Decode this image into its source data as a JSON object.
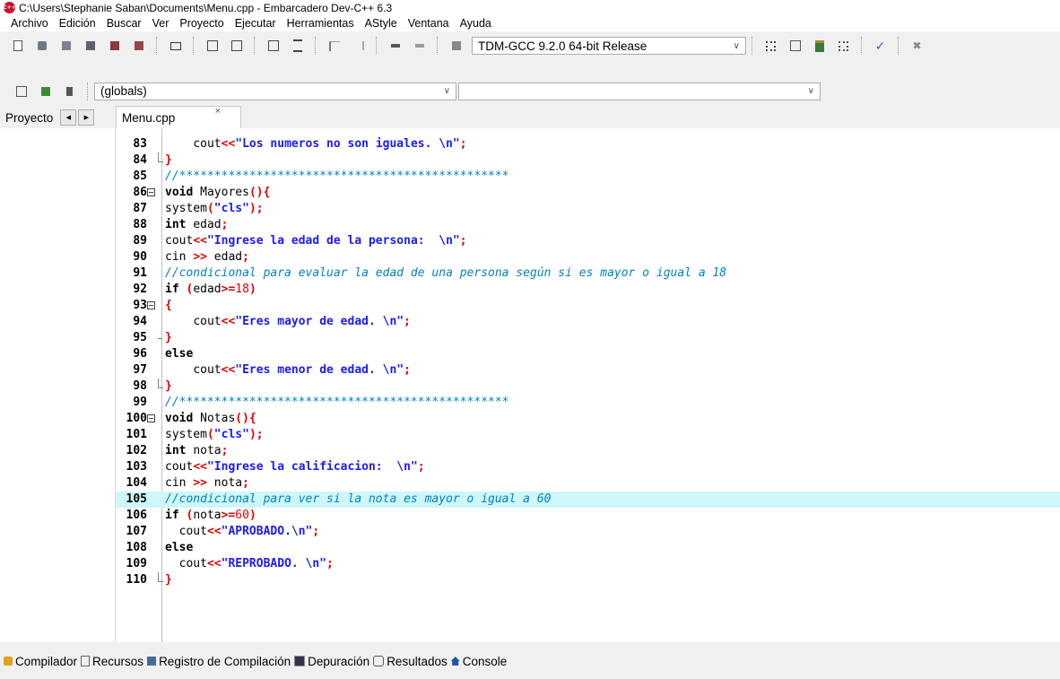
{
  "window": {
    "title": "C:\\Users\\Stephanie Saban\\Documents\\Menu.cpp - Embarcadero Dev-C++ 6.3"
  },
  "menu": [
    "Archivo",
    "Edición",
    "Buscar",
    "Ver",
    "Proyecto",
    "Ejecutar",
    "Herramientas",
    "AStyle",
    "Ventana",
    "Ayuda"
  ],
  "toolbar": {
    "compiler_select": "TDM-GCC 9.2.0 64-bit Release"
  },
  "toolbar2": {
    "scope_select": "(globals)",
    "function_select": ""
  },
  "tabs": {
    "project_panel": "Proyecto",
    "file_tab": "Menu.cpp",
    "close_glyph": "×"
  },
  "editor": {
    "highlight_line": 105,
    "lines": [
      {
        "n": "83",
        "code": "    cout<<\"Los numeros no son iguales. \\n\";"
      },
      {
        "n": "84",
        "code": "}"
      },
      {
        "n": "85",
        "code": "//***********************************************"
      },
      {
        "n": "86",
        "code": "void Mayores(){"
      },
      {
        "n": "87",
        "code": "system(\"cls\");"
      },
      {
        "n": "88",
        "code": "int edad;"
      },
      {
        "n": "89",
        "code": "cout<<\"Ingrese la edad de la persona:  \\n\";"
      },
      {
        "n": "90",
        "code": "cin >> edad;"
      },
      {
        "n": "91",
        "code": "//condicional para evaluar la edad de una persona según si es mayor o igual a 18"
      },
      {
        "n": "92",
        "code": "if (edad>=18)"
      },
      {
        "n": "93",
        "code": "{"
      },
      {
        "n": "94",
        "code": "    cout<<\"Eres mayor de edad. \\n\";"
      },
      {
        "n": "95",
        "code": "}"
      },
      {
        "n": "96",
        "code": "else"
      },
      {
        "n": "97",
        "code": "    cout<<\"Eres menor de edad. \\n\";"
      },
      {
        "n": "98",
        "code": "}"
      },
      {
        "n": "99",
        "code": "//***********************************************"
      },
      {
        "n": "100",
        "code": "void Notas(){"
      },
      {
        "n": "101",
        "code": "system(\"cls\");"
      },
      {
        "n": "102",
        "code": "int nota;"
      },
      {
        "n": "103",
        "code": "cout<<\"Ingrese la calificacion:  \\n\";"
      },
      {
        "n": "104",
        "code": "cin >> nota;"
      },
      {
        "n": "105",
        "code": "//condicional para ver si la nota es mayor o igual a 60"
      },
      {
        "n": "106",
        "code": "if (nota>=60)"
      },
      {
        "n": "107",
        "code": "  cout<<\"APROBADO.\\n\";"
      },
      {
        "n": "108",
        "code": "else"
      },
      {
        "n": "109",
        "code": "  cout<<\"REPROBADO. \\n\";"
      },
      {
        "n": "110",
        "code": "}"
      }
    ]
  },
  "bottom_tabs": [
    "Compilador",
    "Recursos",
    "Registro de Compilación",
    "Depuración",
    "Resultados",
    "Console"
  ]
}
